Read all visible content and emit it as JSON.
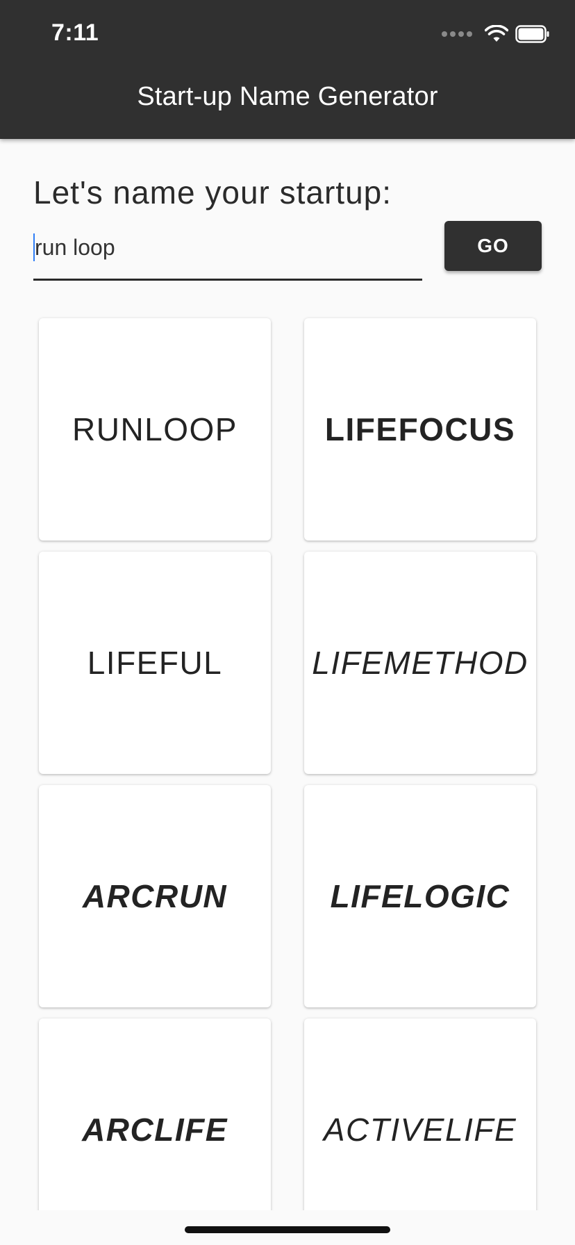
{
  "status_bar": {
    "time": "7:11"
  },
  "app_bar": {
    "title": "Start-up Name Generator"
  },
  "form": {
    "prompt": "Let's name your startup:",
    "input_value": "run loop",
    "go_label": "GO"
  },
  "names": [
    {
      "label": "RUNLOOP",
      "style": "normal"
    },
    {
      "label": "LIFEFOCUS",
      "style": "bold"
    },
    {
      "label": "LIFEFUL",
      "style": "normal"
    },
    {
      "label": "LIFEMETHOD",
      "style": "italic"
    },
    {
      "label": "ARCRUN",
      "style": "bold-italic"
    },
    {
      "label": "LIFELOGIC",
      "style": "bold-italic"
    },
    {
      "label": "ARCLIFE",
      "style": "bold-italic"
    },
    {
      "label": "ACTIVELIFE",
      "style": "italic"
    }
  ],
  "colors": {
    "app_bar": "#303030",
    "background": "#fafafa",
    "card": "#ffffff",
    "caret": "#2f7df6"
  }
}
